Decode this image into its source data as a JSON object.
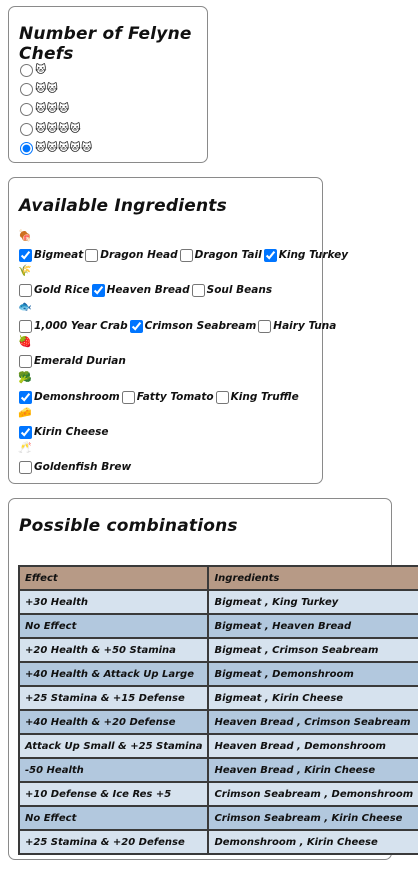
{
  "chefs": {
    "title": "Number of Felyne Chefs",
    "options": [
      {
        "cats": "🐱",
        "selected": false
      },
      {
        "cats": "🐱🐱",
        "selected": false
      },
      {
        "cats": "🐱🐱🐱",
        "selected": false
      },
      {
        "cats": "🐱🐱🐱🐱",
        "selected": false
      },
      {
        "cats": "🐱🐱🐱🐱🐱",
        "selected": true
      }
    ]
  },
  "ingredients": {
    "title": "Available Ingredients",
    "categories": [
      {
        "icon": "🍖",
        "icon_name": "meat-icon",
        "items": [
          {
            "label": "Bigmeat",
            "checked": true
          },
          {
            "label": "Dragon Head",
            "checked": false
          },
          {
            "label": "Dragon Tail",
            "checked": false
          },
          {
            "label": "King Turkey",
            "checked": true
          }
        ]
      },
      {
        "icon": "🌾",
        "icon_name": "grain-icon",
        "items": [
          {
            "label": "Gold Rice",
            "checked": false
          },
          {
            "label": "Heaven Bread",
            "checked": true
          },
          {
            "label": "Soul Beans",
            "checked": false
          }
        ]
      },
      {
        "icon": "🐟",
        "icon_name": "fish-icon",
        "items": [
          {
            "label": "1,000 Year Crab",
            "checked": false
          },
          {
            "label": "Crimson Seabream",
            "checked": true
          },
          {
            "label": "Hairy Tuna",
            "checked": false
          }
        ]
      },
      {
        "icon": "🍓",
        "icon_name": "fruit-icon",
        "items": [
          {
            "label": "Emerald Durian",
            "checked": false
          }
        ]
      },
      {
        "icon": "🥦",
        "icon_name": "vegetable-icon",
        "items": [
          {
            "label": "Demonshroom",
            "checked": true
          },
          {
            "label": "Fatty Tomato",
            "checked": false
          },
          {
            "label": "King Truffle",
            "checked": false
          }
        ]
      },
      {
        "icon": "🧀",
        "icon_name": "cheese-icon",
        "items": [
          {
            "label": "Kirin Cheese",
            "checked": true
          }
        ]
      },
      {
        "icon": "🥂",
        "icon_name": "drink-icon",
        "items": [
          {
            "label": "Goldenfish Brew",
            "checked": false
          }
        ]
      }
    ]
  },
  "combos": {
    "title": "Possible combinations",
    "headers": [
      "Effect",
      "Ingredients"
    ],
    "rows": [
      [
        "+30 Health",
        "Bigmeat , King Turkey"
      ],
      [
        "No Effect",
        "Bigmeat , Heaven Bread"
      ],
      [
        "+20 Health & +50 Stamina",
        "Bigmeat , Crimson Seabream"
      ],
      [
        "+40 Health & Attack Up Large",
        "Bigmeat , Demonshroom"
      ],
      [
        "+25 Stamina & +15 Defense",
        "Bigmeat , Kirin Cheese"
      ],
      [
        "+40 Health & +20 Defense",
        "Heaven Bread , Crimson Seabream"
      ],
      [
        "Attack Up Small & +25 Stamina",
        "Heaven Bread , Demonshroom"
      ],
      [
        "-50 Health",
        "Heaven Bread , Kirin Cheese"
      ],
      [
        "+10 Defense & Ice Res +5",
        "Crimson Seabream , Demonshroom"
      ],
      [
        "No Effect",
        "Crimson Seabream , Kirin Cheese"
      ],
      [
        "+25 Stamina & +20 Defense",
        "Demonshroom , Kirin Cheese"
      ]
    ]
  },
  "colors": {
    "header_bg": "#b79a86",
    "row_light": "#d6e2ee",
    "row_dark": "#b2c8de",
    "border": "#3a3a3a"
  }
}
